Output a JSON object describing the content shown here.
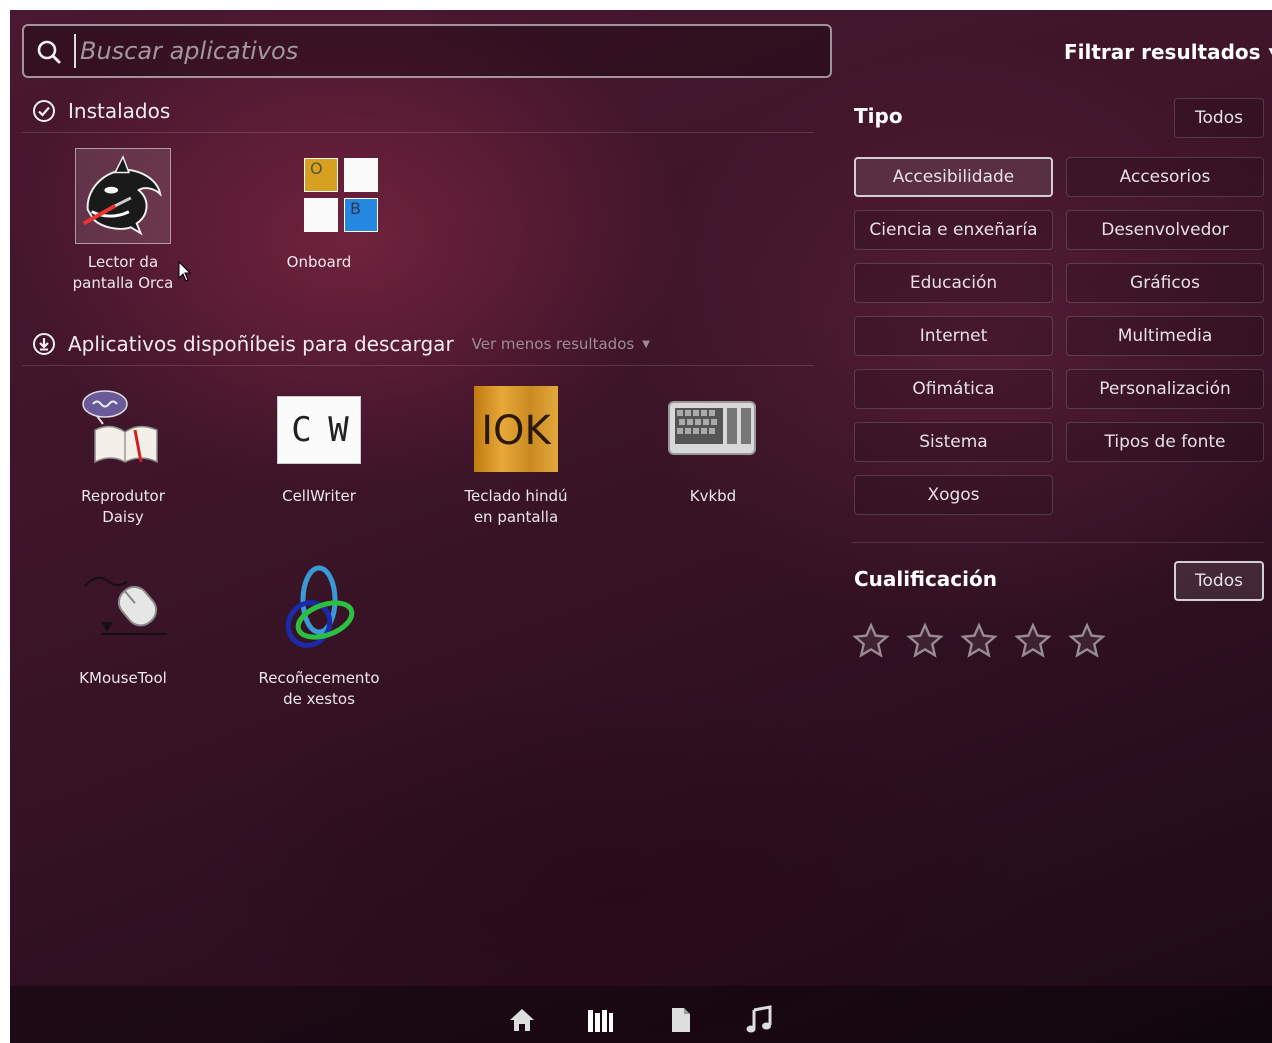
{
  "search": {
    "placeholder": "Buscar aplicativos",
    "value": ""
  },
  "filter_toggle": {
    "label": "Filtrar resultados"
  },
  "installed": {
    "title": "Instalados",
    "apps": [
      {
        "name_lines": [
          "Lector da",
          "pantalla Orca"
        ],
        "icon": "orca-whale-icon"
      },
      {
        "name_lines": [
          "Onboard"
        ],
        "icon": "onboard-keyboard-icon",
        "keys": [
          "O",
          "B"
        ]
      }
    ]
  },
  "available": {
    "title": "Aplicativos dispoñíbeis para descargar",
    "more_label": "Ver menos resultados",
    "apps": [
      {
        "name_lines": [
          "Reprodutor",
          "Daisy"
        ],
        "icon": "daisy-book-icon"
      },
      {
        "name_lines": [
          "CellWriter"
        ],
        "icon": "cellwriter-icon",
        "icon_text": "C W"
      },
      {
        "name_lines": [
          "Teclado hindú",
          "en pantalla"
        ],
        "icon": "iok-icon",
        "icon_text": "IOK"
      },
      {
        "name_lines": [
          "Kvkbd"
        ],
        "icon": "keyboard-icon"
      },
      {
        "name_lines": [
          "KMouseTool"
        ],
        "icon": "mouse-icon"
      },
      {
        "name_lines": [
          "Recoñecemento",
          "de xestos"
        ],
        "icon": "gesture-rings-icon"
      }
    ]
  },
  "filters": {
    "type_label": "Tipo",
    "type_all": "Todos",
    "categories": [
      {
        "label": "Accesibilidade",
        "active": true
      },
      {
        "label": "Accesorios",
        "active": false
      },
      {
        "label": "Ciencia e enxeñaría",
        "active": false
      },
      {
        "label": "Desenvolvedor",
        "active": false
      },
      {
        "label": "Educación",
        "active": false
      },
      {
        "label": "Gráficos",
        "active": false
      },
      {
        "label": "Internet",
        "active": false
      },
      {
        "label": "Multimedia",
        "active": false
      },
      {
        "label": "Ofimática",
        "active": false
      },
      {
        "label": "Personalización",
        "active": false
      },
      {
        "label": "Sistema",
        "active": false
      },
      {
        "label": "Tipos de fonte",
        "active": false
      },
      {
        "label": "Xogos",
        "active": false
      }
    ],
    "rating_label": "Cualificación",
    "rating_all": "Todos",
    "rating_stars": 5
  },
  "lenses": [
    "home-lens-icon",
    "applications-lens-icon",
    "files-lens-icon",
    "music-lens-icon"
  ],
  "colors": {
    "background": "#3c1428",
    "active_border": "#d4d0d2",
    "text": "#e8e2e6"
  }
}
